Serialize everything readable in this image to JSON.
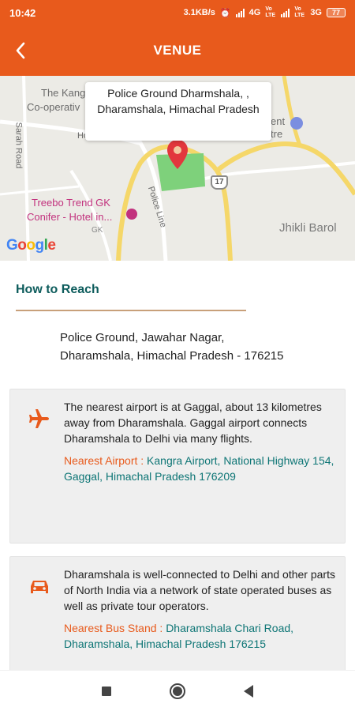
{
  "status_bar": {
    "time": "10:42",
    "speed": "3.1KB/s",
    "network_1": "4G",
    "network_1_sub": "Vo LTE",
    "network_2_sub": "Vo LTE",
    "network_2": "3G",
    "battery": "77",
    "background_color": "#e85a1c"
  },
  "app_bar": {
    "title": "VENUE",
    "back_icon": "chevron-left-icon",
    "background_color": "#e85a1c"
  },
  "map": {
    "callout": "Police Ground Dharmshala, , Dharamshala, Himachal Pradesh",
    "labels": {
      "kangra_coop_1": "The Kang",
      "kangra_coop_2": "Co-operativ",
      "hotel_partial": "Ho",
      "sarah_road": "Sarah Road",
      "police_line": "Police Line",
      "ent": "ent",
      "tre": "tre",
      "jhikli_barol": "Jhikli Barol",
      "route_17": "17",
      "gk": "GK"
    },
    "poi": {
      "treebo_line1": "Treebo Trend GK",
      "treebo_line2": "Conifer - Hotel in..."
    },
    "google_logo": "Google"
  },
  "how_to_reach": {
    "heading": "How to Reach",
    "address_line1": "Police Ground, Jawahar Nagar,",
    "address_line2": "Dharamshala, Himachal Pradesh - 176215"
  },
  "cards": {
    "airport": {
      "icon": "airplane-icon",
      "text": "The nearest airport is at Gaggal, about 13 kilometres away from Dharamshala. Gaggal airport connects Dharamshala to Delhi via many flights.",
      "nearest_label": "Nearest Airport : ",
      "nearest_value": "Kangra Airport, National Highway 154, Gaggal, Himachal Pradesh 176209"
    },
    "bus": {
      "icon": "car-icon",
      "text": "Dharamshala is well-connected to Delhi and other parts of North India via a network of state operated buses as well as private tour operators.",
      "nearest_label": "Nearest Bus Stand : ",
      "nearest_value": "Dharamshala Chari Road, Dharamshala, Himachal Pradesh 176215"
    }
  },
  "colors": {
    "accent": "#e85a1c",
    "teal": "#0d7575",
    "heading_teal": "#0d5c5c",
    "rule": "#c8a07a",
    "card_bg": "#efefef"
  },
  "nav_bar": {
    "recents_icon": "square-recents-icon",
    "home_icon": "circle-home-icon",
    "back_icon": "triangle-back-icon"
  }
}
